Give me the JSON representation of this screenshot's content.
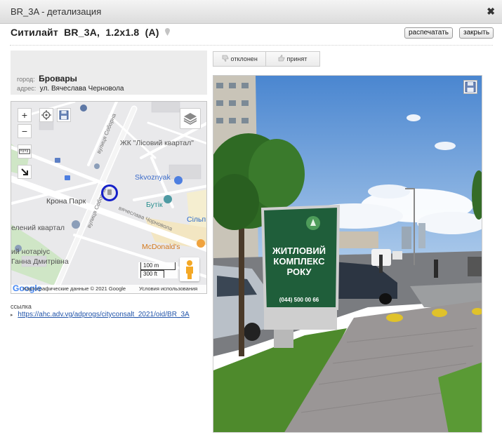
{
  "window": {
    "title": "BR_3A - детализация",
    "close_glyph": "✖"
  },
  "header": {
    "type": "Ситилайт",
    "code": "BR_3A,",
    "size": "1.2x1.8",
    "side": "(A)",
    "print_label": "распечатать",
    "close_label": "закрыть"
  },
  "address": {
    "city_label": "город:",
    "city": "Бровары",
    "street_label": "адрес:",
    "street": "ул. Вячеслава Черновола"
  },
  "map": {
    "zoom_in": "+",
    "zoom_out": "−",
    "labels": {
      "lisovyi": "ЖК \"Лісовий квартал\"",
      "skvoznyak": "Skvoznyak",
      "krona": "Крона Парк",
      "butik": "Бутік",
      "silpo": "Сільп",
      "kvartal": "елений квартал",
      "mcdonalds": "McDonald's",
      "notarius": "ий нотаріус",
      "hanna": "Ганна Дмитрівна",
      "street_sob1": "вулиця Соборна",
      "street_sob2": "вулиця Соборна",
      "street_chern": "вячеслава Чорновола"
    },
    "scale_m": "100 m",
    "scale_ft": "300 ft",
    "google": "Google",
    "map_data": "Картографические данные © 2021 Google",
    "terms": "Условия использования"
  },
  "link": {
    "caption": "ссылка",
    "url": "https://ahc.adv.vg/adprogs/cityconsalt_2021/oid/BR_3A"
  },
  "status": {
    "reject": "отклонен",
    "accept": "принят"
  },
  "photo": {
    "billboard_line1": "ЖИТЛОВИЙ",
    "billboard_line2": "КОМПЛЕКС",
    "billboard_line3": "РОКУ",
    "billboard_phone": "(044) 500 00 66"
  },
  "colors": {
    "map_marker": "#1520c8",
    "link": "#2255aa",
    "billboard_green": "#1f5e3a",
    "sky": "#5b95d6"
  }
}
